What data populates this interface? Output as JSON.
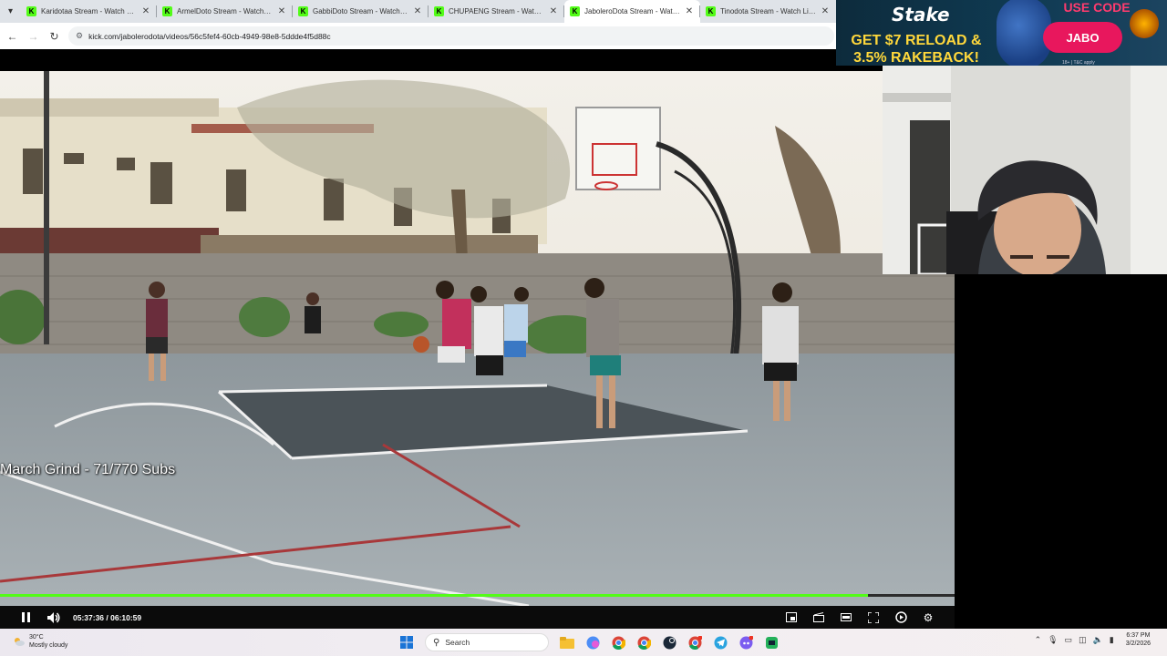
{
  "browser": {
    "tabs": [
      {
        "title": "Karidotaa Stream - Watch Live"
      },
      {
        "title": "ArmelDoto Stream - Watch Live"
      },
      {
        "title": "GabbiDoto Stream - Watch Live"
      },
      {
        "title": "CHUPAENG Stream - Watch Live"
      },
      {
        "title": "JaboleroDota Stream - Watch L"
      },
      {
        "title": "Tinodota Stream - Watch Live"
      }
    ],
    "url": "kick.com/jabolerodota/videos/56c5fef4-60cb-4949-98e8-5ddde4f5d88c"
  },
  "ad": {
    "brand": "Stake",
    "line1": "GET $7 RELOAD &",
    "line2": "3.5% RAKEBACK!",
    "use_code_label": "USE CODE",
    "code": "JABO",
    "fine_print": "18+ | T&C apply"
  },
  "video": {
    "overlay_text": "March Grind - 71/770 Subs",
    "time_display": "05:37:36 / 06:10:59",
    "progress_fraction": 0.9096
  },
  "icons": {
    "play_pause": "pause-icon",
    "volume": "volume-icon",
    "miniplayer": "miniplayer-icon",
    "theater": "theater-icon",
    "pip": "pip-icon",
    "fullscreen": "fullscreen-icon",
    "clip": "clip-icon",
    "settings": "gear-icon"
  },
  "taskbar": {
    "weather_temp": "30°C",
    "weather_desc": "Mostly cloudy",
    "search_placeholder": "Search",
    "time": "6:37 PM",
    "date": "3/2/2026"
  },
  "colors": {
    "kick_green": "#53fc18",
    "ad_yellow": "#ffd83b",
    "ad_pink": "#e8175d"
  }
}
